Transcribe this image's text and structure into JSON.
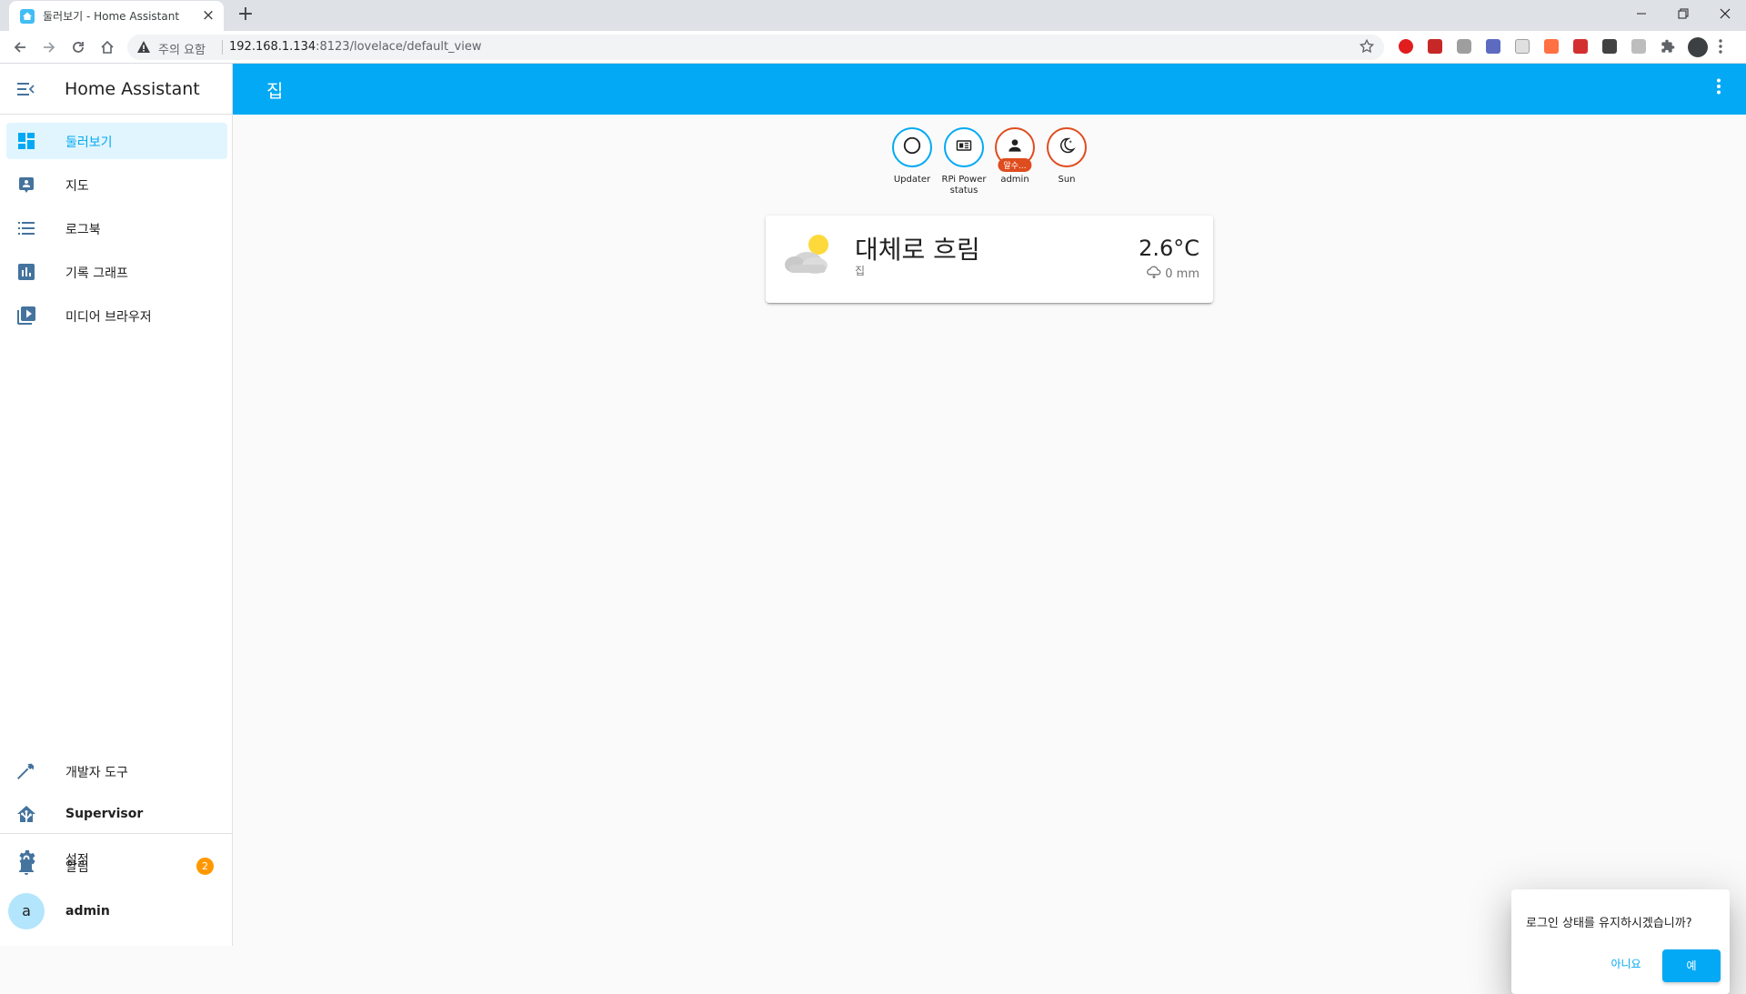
{
  "browser": {
    "tab_title": "둘러보기 - Home Assistant",
    "new_tab": "+",
    "security_label": "주의 요함",
    "url_host": "192.168.1.134",
    "url_rest": ":8123/lovelace/default_view"
  },
  "sidebar": {
    "title": "Home Assistant",
    "items": [
      {
        "label": "둘러보기",
        "icon": "dashboard-icon"
      },
      {
        "label": "지도",
        "icon": "map-account-icon"
      },
      {
        "label": "로그북",
        "icon": "logbook-list-icon"
      },
      {
        "label": "기록 그래프",
        "icon": "history-chart-icon"
      },
      {
        "label": "미디어 브라우저",
        "icon": "media-browser-icon"
      }
    ],
    "bottom_items": [
      {
        "label": "개발자 도구",
        "icon": "hammer-icon"
      },
      {
        "label": "Supervisor",
        "icon": "home-assistant-icon"
      },
      {
        "label": "설정",
        "icon": "gear-icon"
      }
    ],
    "notifications": {
      "label": "알림",
      "count": "2"
    },
    "user": {
      "initial": "a",
      "name": "admin"
    }
  },
  "topbar": {
    "title": "집"
  },
  "badges": [
    {
      "label": "Updater",
      "icon": "circle-outline-icon"
    },
    {
      "label": "RPi Power status",
      "icon": "raspberry-pi-icon"
    },
    {
      "label": "admin",
      "icon": "person-icon",
      "state": "알수..."
    },
    {
      "label": "Sun",
      "icon": "moon-icon"
    }
  ],
  "weather": {
    "state": "대체로 흐림",
    "name": "집",
    "temperature": "2.6°C",
    "precipitation": "0 mm"
  },
  "dialog": {
    "message": "로그인 상태를 유지하시겠습니까?",
    "no_label": "아니요",
    "yes_label": "예"
  },
  "colors": {
    "primary": "#03a9f4",
    "icon": "#44739e",
    "accent": "#ff9800",
    "badge_red": "#df4c1e"
  }
}
